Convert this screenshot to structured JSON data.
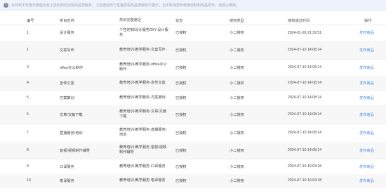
{
  "notice": {
    "text": "本列表中仅展示那些还有上述权利的授权的品类服务，之前通过线下签署授权的品类服务不展示，也不影响您的使用授权和商品发布，请放心使用。"
  },
  "table": {
    "headers": [
      "编号",
      "类目名称",
      "类目完整路径",
      "状态",
      "授权类型",
      "授权通过时间",
      "操作"
    ],
    "rows": [
      {
        "id": "1",
        "name": "设计服务",
        "path": "个性定制/设计服务/DIY-设计服务",
        "status": "已授权",
        "type": "小二授权",
        "time": "2024-01-26 21:32:51",
        "action": "发布商品"
      },
      {
        "id": "1",
        "name": "文案写作",
        "path": "教育培训-教学服务-文案写作",
        "status": "已授权",
        "type": "小二授权",
        "time": "2024-07-10 14:08:14",
        "action": "发布商品"
      },
      {
        "id": "3",
        "name": "office办公制作",
        "path": "教育培训-教学服务-office办公制作",
        "status": "已授权",
        "type": "小二授权",
        "time": "2024-07-10 14:08:14",
        "action": "发布商品"
      },
      {
        "id": "4",
        "name": "宣传文案",
        "path": "教育培训-教学服务-宣传文案",
        "status": "已授权",
        "type": "小二授权",
        "time": "2024-07-10 14:08:14",
        "action": "发布商品"
      },
      {
        "id": "5",
        "name": "方案策划",
        "path": "教育培训-教学服务-方案策划",
        "status": "已授权",
        "type": "小二授权",
        "time": "2024-07-10 14:08:14",
        "action": "发布商品"
      },
      {
        "id": "6",
        "name": "文章/文献下载",
        "path": "教育培训-教学服务-文章/文献下载",
        "status": "已授权",
        "type": "小二授权",
        "time": "2024-07-10 14:08:14",
        "action": "发布商品"
      },
      {
        "id": "7",
        "name": "直播服务/培训",
        "path": "教育培训-教学服务-直播服务/培训",
        "status": "已授权",
        "type": "小二授权",
        "time": "2024-07-10 14:08:14",
        "action": "发布商品"
      },
      {
        "id": "8",
        "name": "音视/视频制作辅导",
        "path": "教育培训-教学服务-音视/视频制作辅导",
        "status": "已授权",
        "type": "小二授权",
        "time": "2024-07-10 14:08:14",
        "action": "发布商品"
      },
      {
        "id": "9",
        "name": "口译服务",
        "path": "教育培训-教学服务-口译服务",
        "status": "已授权",
        "type": "小二授权",
        "time": "2024-07-10 16:04:18",
        "action": "发布商品"
      },
      {
        "id": "10",
        "name": "笔译服务",
        "path": "教育培训-教学服务-笔译服务",
        "status": "已授权",
        "type": "小二授权",
        "time": "2024-07-10 16:04:18",
        "action": "发布商品"
      }
    ]
  }
}
